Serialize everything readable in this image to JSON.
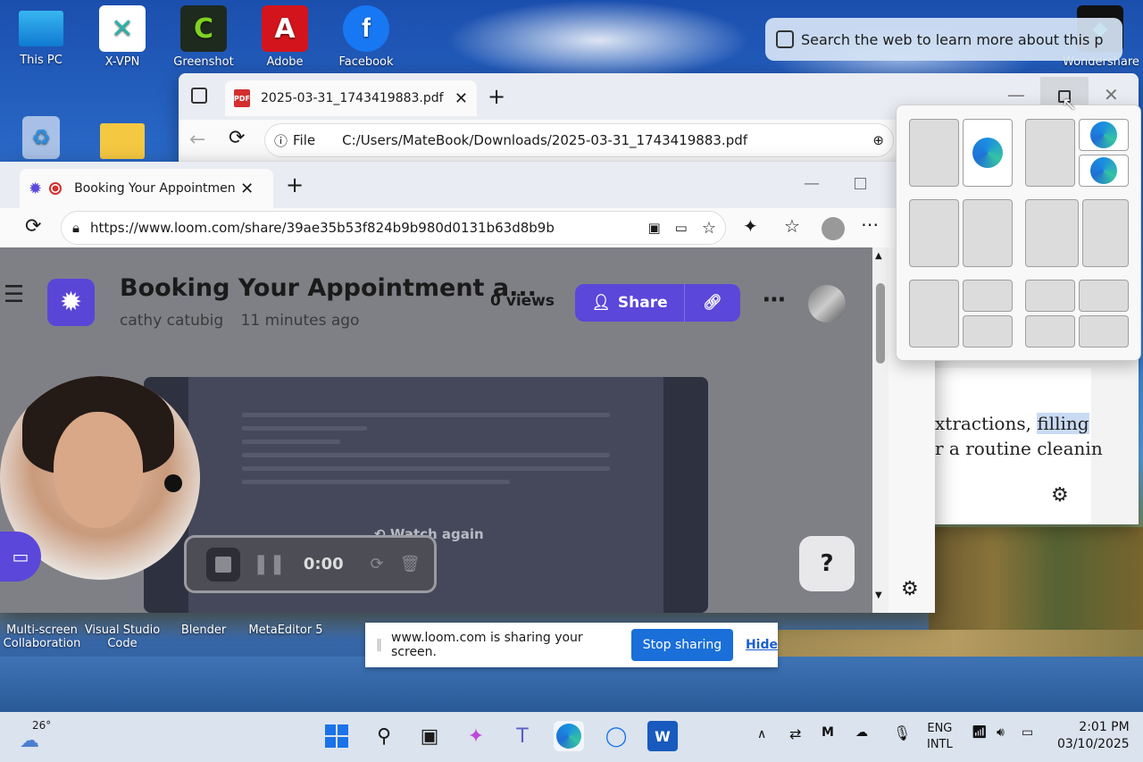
{
  "desktop": {
    "icons": [
      {
        "label": "This PC"
      },
      {
        "label": "X-VPN"
      },
      {
        "label": "Greenshot"
      },
      {
        "label": "Adobe"
      },
      {
        "label": "Facebook"
      },
      {
        "label": "Wondershare"
      }
    ],
    "bottom_icons": [
      {
        "label": "Multi-screen Collaboration"
      },
      {
        "label": "Visual Studio Code"
      },
      {
        "label": "Blender"
      },
      {
        "label": "MetaEditor 5"
      }
    ],
    "search_pill": "Search the web to learn more about this p"
  },
  "pdf_window": {
    "tab_title": "2025-03-31_1743419883.pdf",
    "file_chip": "File",
    "address": "C:/Users/MateBook/Downloads/2025-03-31_1743419883.pdf",
    "pdf_text_line1_a": "xtractions, ",
    "pdf_text_line1_b": "filling",
    "pdf_text_line2": "r a routine cleanin"
  },
  "loom_window": {
    "tab_title": "Booking Your Appointment a",
    "address": "https://www.loom.com/share/39ae35b53f824b9b980d0131b63d8b9b",
    "video_title": "Booking Your Appointment a...",
    "author": "cathy catubig",
    "time_ago": "11 minutes ago",
    "views": "0 views",
    "share_label": "Share",
    "watch_again": "Watch again",
    "timer": "0:00",
    "help": "?"
  },
  "sharing_bar": {
    "message": "www.loom.com is sharing your screen.",
    "stop": "Stop sharing",
    "hide": "Hide"
  },
  "taskbar": {
    "weather_temp": "26°",
    "lang1": "ENG",
    "lang2": "INTL",
    "time": "2:01 PM",
    "date": "03/10/2025"
  }
}
